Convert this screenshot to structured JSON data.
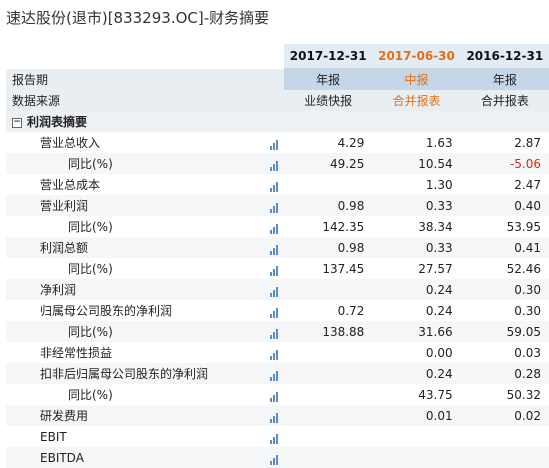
{
  "page": {
    "title": "速达股份(退市)[833293.OC]-财务摘要"
  },
  "columns": [
    {
      "date": "2017-12-31",
      "highlight": false
    },
    {
      "date": "2017-06-30",
      "highlight": true
    },
    {
      "date": "2016-12-31",
      "highlight": false
    }
  ],
  "meta_rows": [
    {
      "label": "报告期",
      "values": [
        "年报",
        "中报",
        "年报"
      ]
    },
    {
      "label": "数据来源",
      "values": [
        "业绩快报",
        "合并报表",
        "合并报表"
      ]
    }
  ],
  "section": {
    "label": "利润表摘要",
    "toggle_icon": "minus-box-icon"
  },
  "rows": [
    {
      "label": "营业总收入",
      "indent": 1,
      "values": [
        "4.29",
        "1.63",
        "2.87"
      ]
    },
    {
      "label": "同比(%)",
      "indent": 2,
      "values": [
        "49.25",
        "10.54",
        "-5.06"
      ]
    },
    {
      "label": "营业总成本",
      "indent": 1,
      "values": [
        "",
        "1.30",
        "2.47"
      ]
    },
    {
      "label": "营业利润",
      "indent": 1,
      "values": [
        "0.98",
        "0.33",
        "0.40"
      ]
    },
    {
      "label": "同比(%)",
      "indent": 2,
      "values": [
        "142.35",
        "38.34",
        "53.95"
      ]
    },
    {
      "label": "利润总额",
      "indent": 1,
      "values": [
        "0.98",
        "0.33",
        "0.41"
      ]
    },
    {
      "label": "同比(%)",
      "indent": 2,
      "values": [
        "137.45",
        "27.57",
        "52.46"
      ]
    },
    {
      "label": "净利润",
      "indent": 1,
      "values": [
        "",
        "0.24",
        "0.30"
      ]
    },
    {
      "label": "归属母公司股东的净利润",
      "indent": 1,
      "values": [
        "0.72",
        "0.24",
        "0.30"
      ]
    },
    {
      "label": "同比(%)",
      "indent": 2,
      "values": [
        "138.88",
        "31.66",
        "59.05"
      ]
    },
    {
      "label": "非经常性损益",
      "indent": 1,
      "values": [
        "",
        "0.00",
        "0.03"
      ]
    },
    {
      "label": "扣非后归属母公司股东的净利润",
      "indent": 1,
      "values": [
        "",
        "0.24",
        "0.28"
      ]
    },
    {
      "label": "同比(%)",
      "indent": 2,
      "values": [
        "",
        "43.75",
        "50.32"
      ]
    },
    {
      "label": "研发费用",
      "indent": 1,
      "values": [
        "",
        "0.01",
        "0.02"
      ]
    },
    {
      "label": "EBIT",
      "indent": 1,
      "values": [
        "",
        "",
        ""
      ]
    },
    {
      "label": "EBITDA",
      "indent": 1,
      "values": [
        "",
        "",
        ""
      ]
    }
  ],
  "chart_icon": "bar-chart-icon",
  "colors": {
    "highlight": "#e0701a",
    "negative": "#d9261c",
    "icon": "#5b8cc4",
    "header_bg": "#e3ebf3"
  }
}
